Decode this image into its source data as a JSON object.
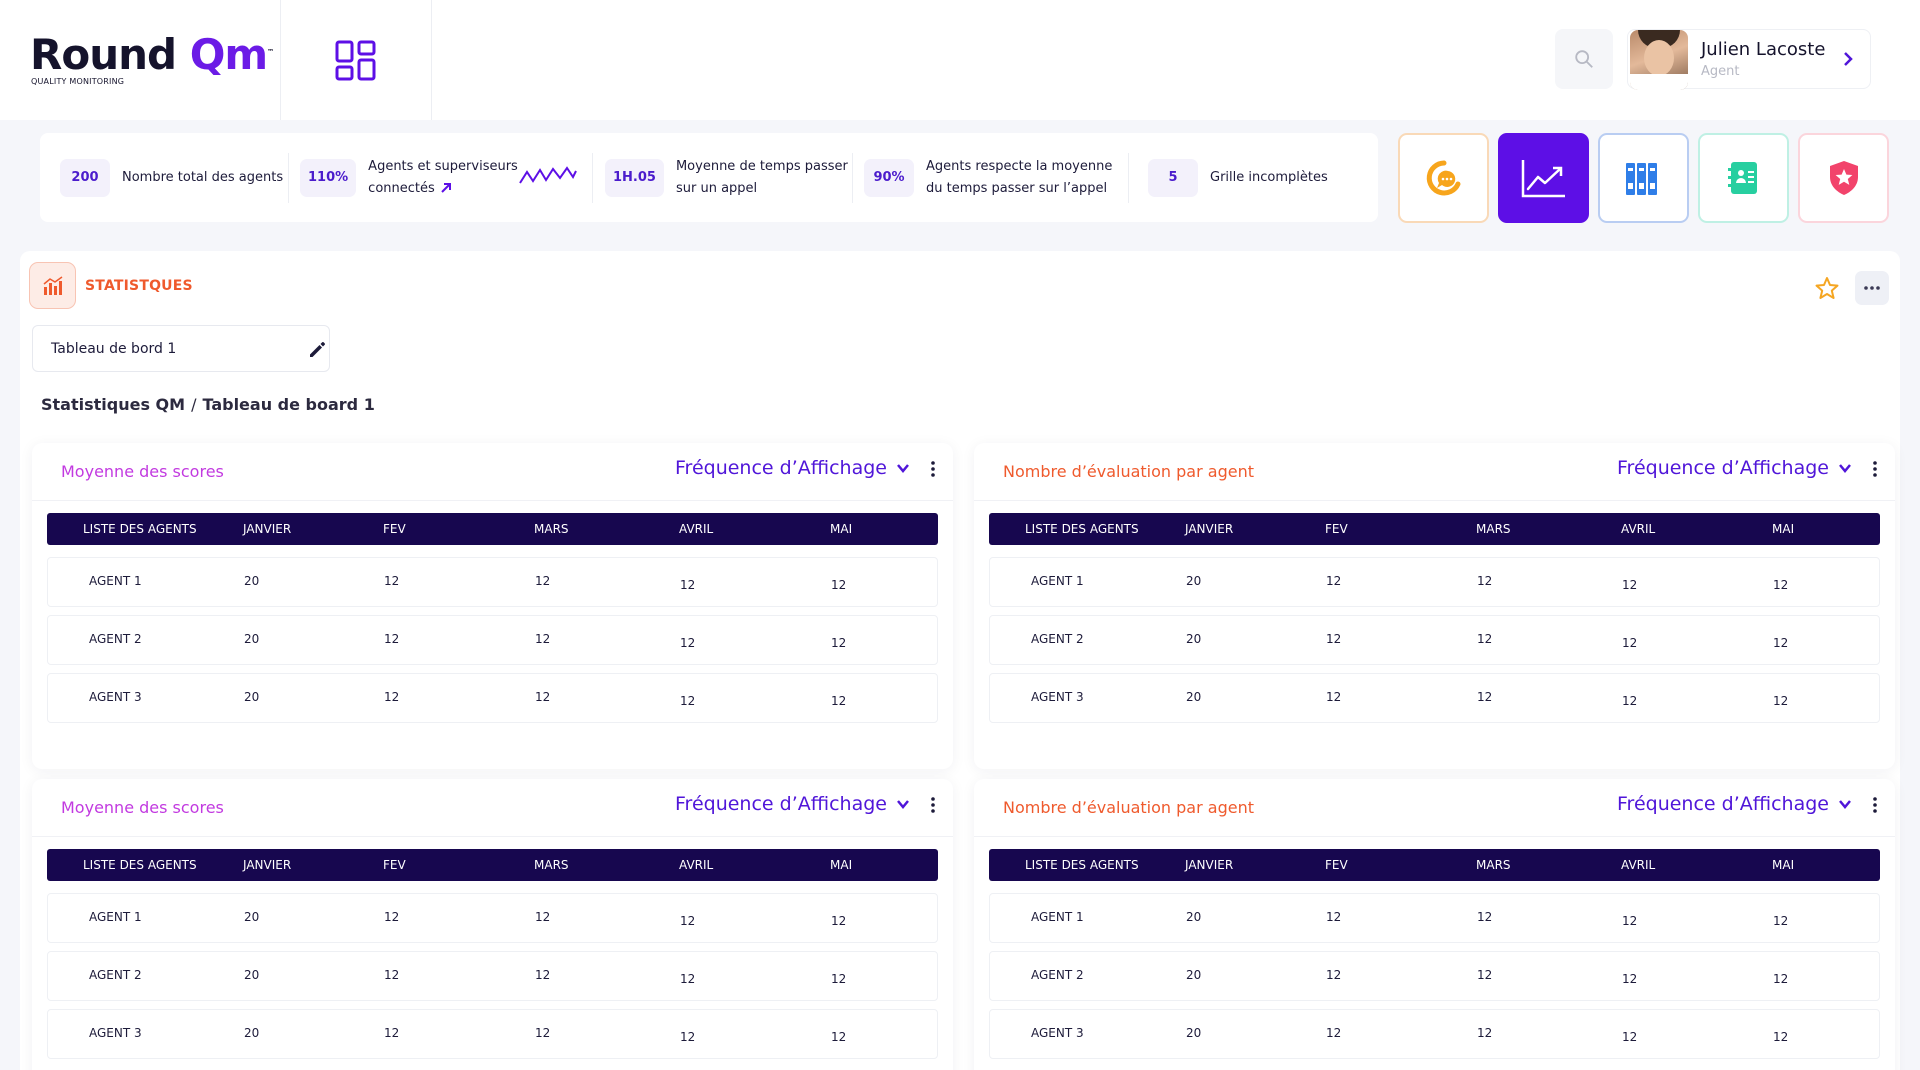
{
  "brand": {
    "name": "Round ",
    "name_accent": "Qm",
    "trademark": "™",
    "tagline": "QUALITY MONITORING"
  },
  "user": {
    "name": "Julien Lacoste",
    "role": "Agent"
  },
  "stats": [
    {
      "value": "200",
      "label": "Nombre total des agents"
    },
    {
      "value": "110%",
      "label_line1": "Agents et superviseurs",
      "label_line2": "connectés"
    },
    {
      "value": "1H.05",
      "label_line1": "Moyenne de temps passer",
      "label_line2": "sur un appel"
    },
    {
      "value": "90%",
      "label_line1": "Agents respecte la moyenne",
      "label_line2": "du temps passer sur l’appel"
    },
    {
      "value": "5",
      "label": "Grille incomplètes"
    }
  ],
  "app_tiles": [
    "chat-app-icon",
    "statistics-app-icon",
    "archive-app-icon",
    "contacts-app-icon",
    "security-app-icon"
  ],
  "section": {
    "title": "STATISTQUES"
  },
  "dashboard_name": "Tableau de bord 1",
  "breadcrumb": {
    "root": "Statistiques QM",
    "separator": "/",
    "current": "Tableau de board 1"
  },
  "widgets": [
    {
      "title": "Moyenne des scores",
      "frequency_label": "Fréquence d’Affichage",
      "columns": [
        "LISTE DES AGENTS",
        "JANVIER",
        "FEV",
        "MARS",
        "AVRIL",
        "MAI"
      ],
      "rows": [
        [
          "AGENT 1",
          "20",
          "12",
          "12",
          "12",
          "12"
        ],
        [
          "AGENT 2",
          "20",
          "12",
          "12",
          "12",
          "12"
        ],
        [
          "AGENT 3",
          "20",
          "12",
          "12",
          "12",
          "12"
        ]
      ]
    },
    {
      "title": "Nombre d’évaluation par agent",
      "frequency_label": "Fréquence d’Affichage",
      "columns": [
        "LISTE DES AGENTS",
        "JANVIER",
        "FEV",
        "MARS",
        "AVRIL",
        "MAI"
      ],
      "rows": [
        [
          "AGENT 1",
          "20",
          "12",
          "12",
          "12",
          "12"
        ],
        [
          "AGENT 2",
          "20",
          "12",
          "12",
          "12",
          "12"
        ],
        [
          "AGENT 3",
          "20",
          "12",
          "12",
          "12",
          "12"
        ]
      ]
    },
    {
      "title": "Moyenne des scores",
      "frequency_label": "Fréquence d’Affichage",
      "columns": [
        "LISTE DES AGENTS",
        "JANVIER",
        "FEV",
        "MARS",
        "AVRIL",
        "MAI"
      ],
      "rows": [
        [
          "AGENT 1",
          "20",
          "12",
          "12",
          "12",
          "12"
        ],
        [
          "AGENT 2",
          "20",
          "12",
          "12",
          "12",
          "12"
        ],
        [
          "AGENT 3",
          "20",
          "12",
          "12",
          "12",
          "12"
        ]
      ]
    },
    {
      "title": "Nombre d’évaluation par agent",
      "frequency_label": "Fréquence d’Affichage",
      "columns": [
        "LISTE DES AGENTS",
        "JANVIER",
        "FEV",
        "MARS",
        "AVRIL",
        "MAI"
      ],
      "rows": [
        [
          "AGENT 1",
          "20",
          "12",
          "12",
          "12",
          "12"
        ],
        [
          "AGENT 2",
          "20",
          "12",
          "12",
          "12",
          "12"
        ],
        [
          "AGENT 3",
          "20",
          "12",
          "12",
          "12",
          "12"
        ]
      ]
    }
  ],
  "colors": {
    "brand_purple": "#5d0fe6",
    "table_header": "#17074f",
    "accent_orange": "#ef5a2d",
    "title_purple": "#c23ae0",
    "frequency_purple": "#5016d9"
  }
}
